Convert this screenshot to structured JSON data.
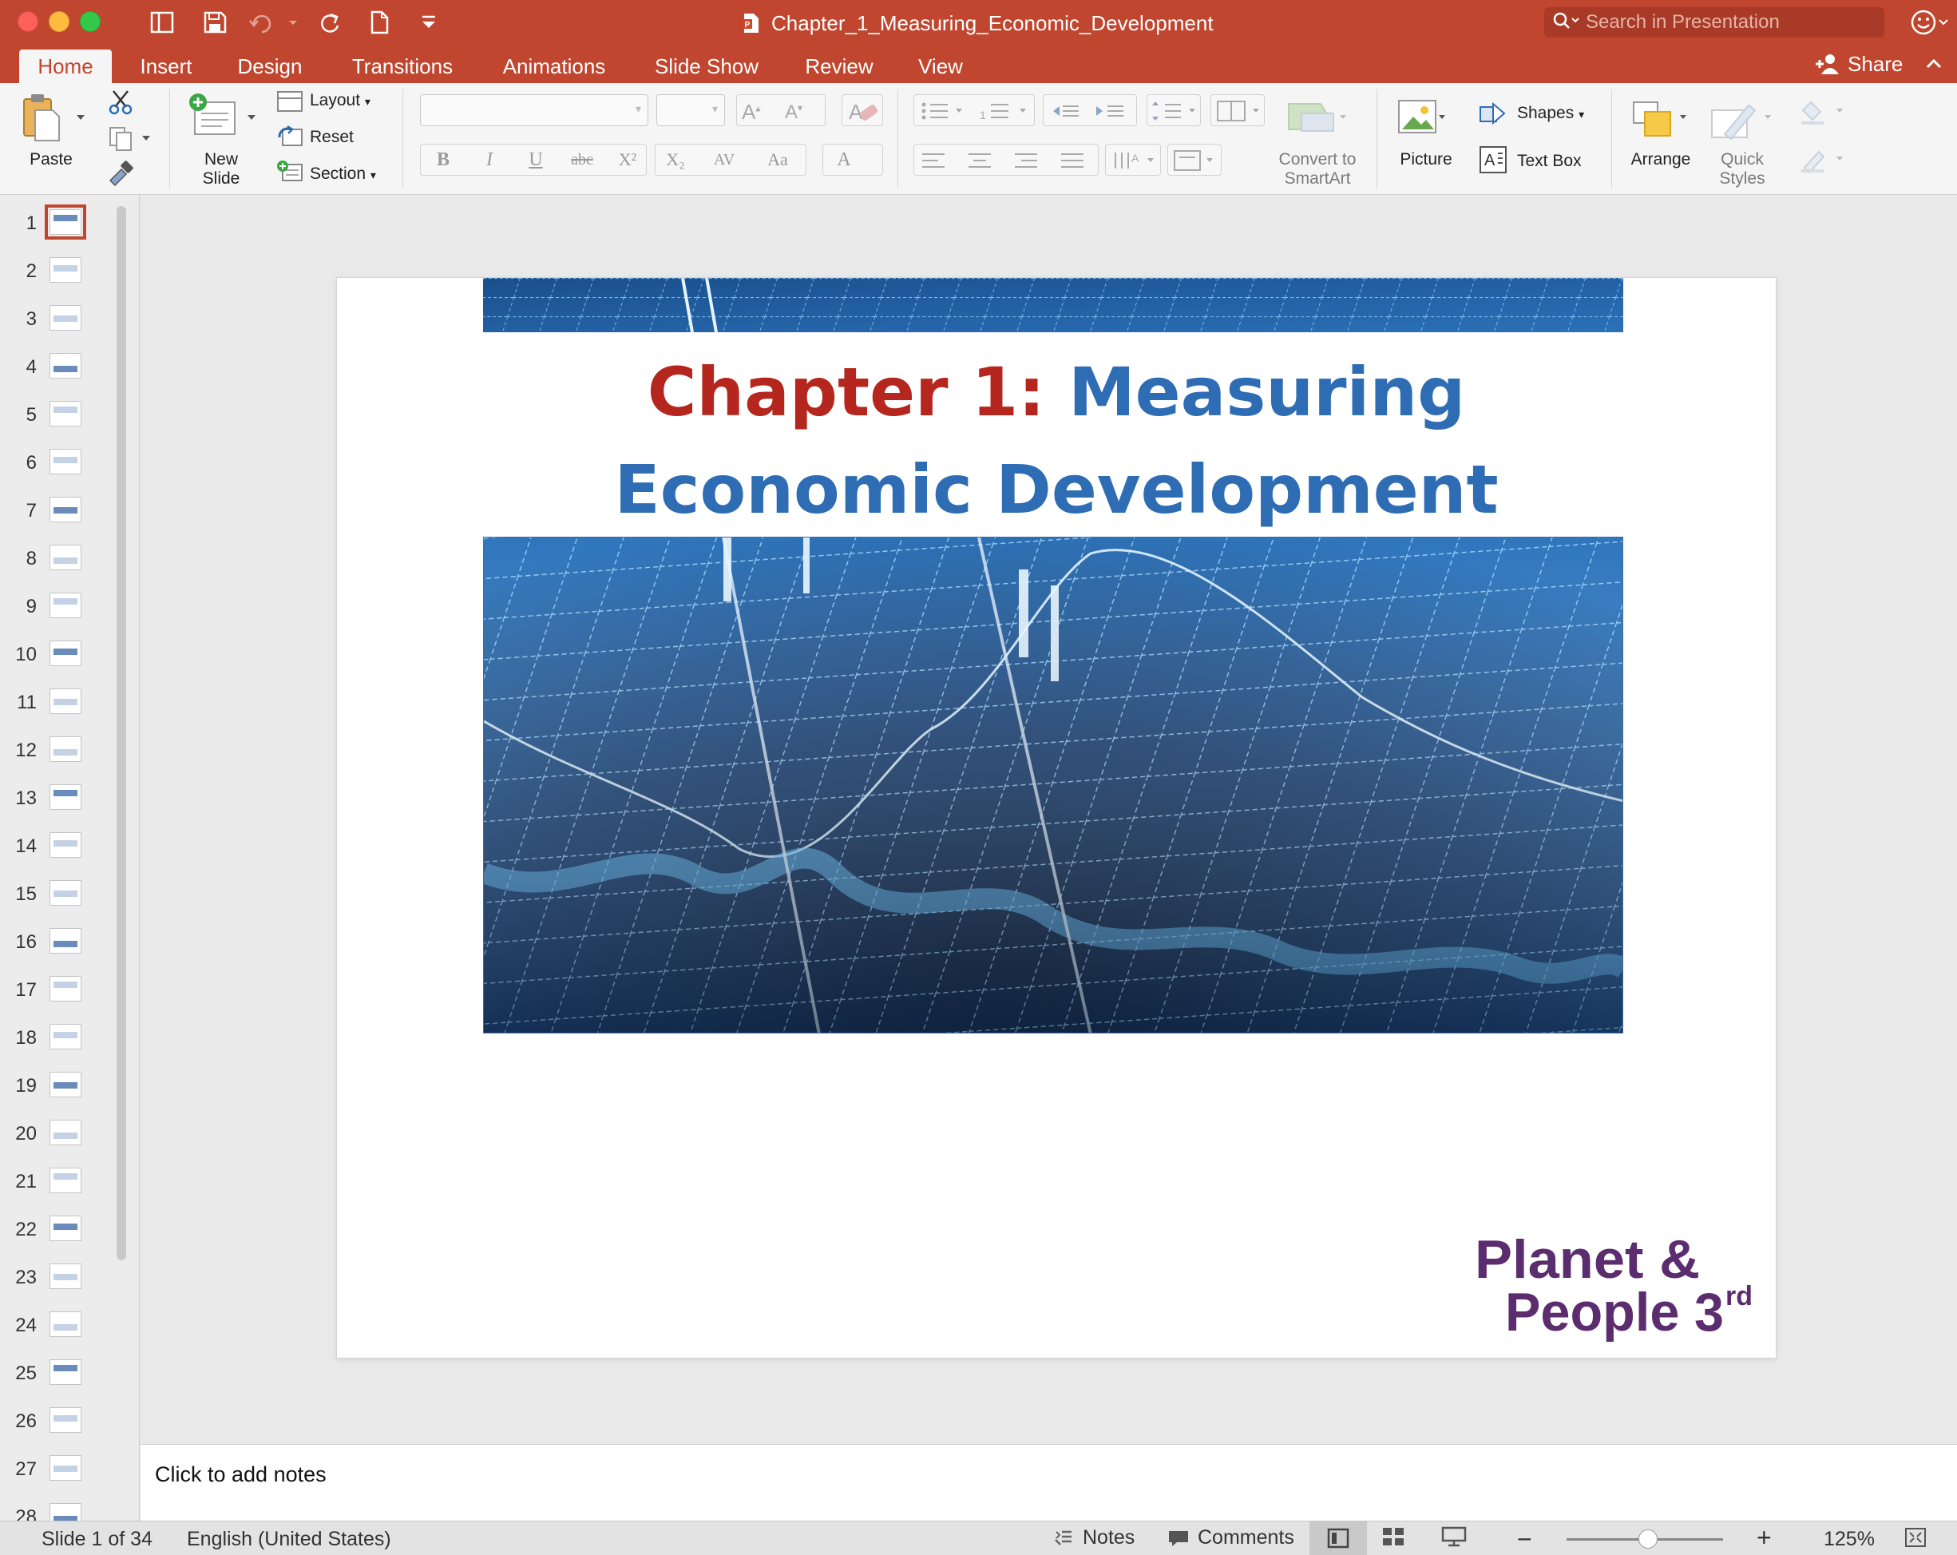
{
  "window": {
    "title": "Chapter_1_Measuring_Economic_Development",
    "search_placeholder": "Search in Presentation",
    "share_label": "Share"
  },
  "tabs": [
    {
      "label": "Home",
      "active": true
    },
    {
      "label": "Insert"
    },
    {
      "label": "Design"
    },
    {
      "label": "Transitions"
    },
    {
      "label": "Animations"
    },
    {
      "label": "Slide Show"
    },
    {
      "label": "Review"
    },
    {
      "label": "View"
    }
  ],
  "ribbon": {
    "paste": "Paste",
    "new_slide_line1": "New",
    "new_slide_line2": "Slide",
    "layout": "Layout",
    "reset": "Reset",
    "section": "Section",
    "convert_line1": "Convert to",
    "convert_line2": "SmartArt",
    "picture": "Picture",
    "shapes": "Shapes",
    "text_box": "Text Box",
    "arrange": "Arrange",
    "quick_styles_line1": "Quick",
    "quick_styles_line2": "Styles",
    "format_buttons": [
      "B",
      "I",
      "U",
      "abc",
      "X²",
      "X₂",
      "AV",
      "Aa",
      "A"
    ]
  },
  "slides": {
    "count": 34,
    "selected": 1,
    "visible_numbers": [
      "1",
      "2",
      "3",
      "4",
      "5",
      "6",
      "7",
      "8",
      "9",
      "10",
      "11",
      "12",
      "13",
      "14",
      "15",
      "16",
      "17",
      "18",
      "19",
      "20",
      "21",
      "22",
      "23",
      "24",
      "25",
      "26",
      "27",
      "28"
    ]
  },
  "slide": {
    "title_red": "Chapter 1:",
    "title_blue_1": " Measuring",
    "title_blue_2": "Economic Development",
    "logo_line1": "Planet &",
    "logo_line2": "People 3",
    "logo_sup": "rd"
  },
  "notes_placeholder": "Click to add notes",
  "status": {
    "slide_indicator": "Slide 1 of 34",
    "language": "English (United States)",
    "notes": "Notes",
    "comments": "Comments",
    "zoom": "125%",
    "zoom_fraction": 0.52
  },
  "colors": {
    "accent": "#c0462f",
    "title_red": "#b5261e",
    "title_blue": "#2e6db4",
    "logo_purple": "#5b2d6e"
  }
}
